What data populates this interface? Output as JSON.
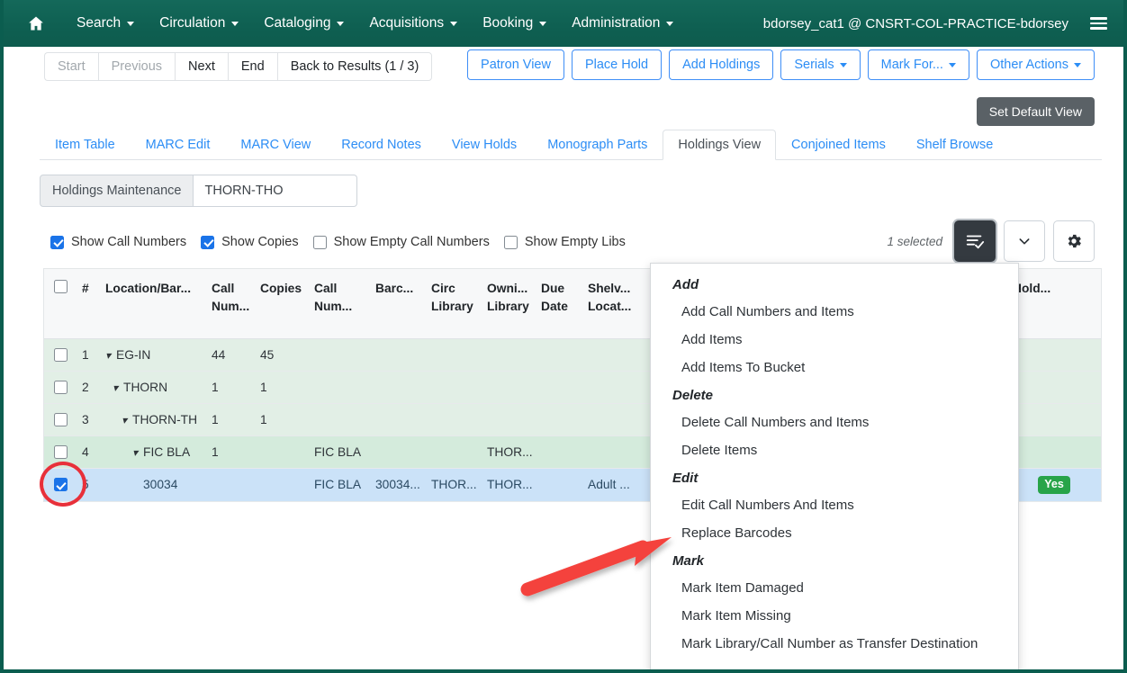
{
  "navbar": {
    "home_icon": "home-icon",
    "items": [
      {
        "label": "Search",
        "caret": true
      },
      {
        "label": "Circulation",
        "caret": true
      },
      {
        "label": "Cataloging",
        "caret": true
      },
      {
        "label": "Acquisitions",
        "caret": true
      },
      {
        "label": "Booking",
        "caret": true
      },
      {
        "label": "Administration",
        "caret": true
      }
    ],
    "user": "bdorsey_cat1 @ CNSRT-COL-PRACTICE-bdorsey",
    "menu_icon": "hamburger-menu-icon",
    "background_color": "#0f6052"
  },
  "toolbar": {
    "nav_buttons": [
      {
        "label": "Start",
        "disabled": true
      },
      {
        "label": "Previous",
        "disabled": true
      },
      {
        "label": "Next",
        "disabled": false
      },
      {
        "label": "End",
        "disabled": false
      },
      {
        "label": "Back to Results (1 / 3)",
        "disabled": false
      }
    ],
    "action_buttons": [
      {
        "label": "Patron View",
        "caret": false
      },
      {
        "label": "Place Hold",
        "caret": false
      },
      {
        "label": "Add Holdings",
        "caret": false
      },
      {
        "label": "Serials",
        "caret": true
      },
      {
        "label": "Mark For...",
        "caret": true
      },
      {
        "label": "Other Actions",
        "caret": true
      }
    ],
    "accent_color": "#2c8df5"
  },
  "tabs": {
    "items": [
      {
        "label": "Item Table",
        "active": false
      },
      {
        "label": "MARC Edit",
        "active": false
      },
      {
        "label": "MARC View",
        "active": false
      },
      {
        "label": "Record Notes",
        "active": false
      },
      {
        "label": "View Holds",
        "active": false
      },
      {
        "label": "Monograph Parts",
        "active": false
      },
      {
        "label": "Holdings View",
        "active": true
      },
      {
        "label": "Conjoined Items",
        "active": false
      },
      {
        "label": "Shelf Browse",
        "active": false
      }
    ],
    "set_default_view": "Set Default View"
  },
  "holdings_maintenance": {
    "label": "Holdings Maintenance",
    "value": "THORN-THO",
    "placeholder": ""
  },
  "display_options": [
    {
      "label": "Show Call Numbers",
      "checked": true
    },
    {
      "label": "Show Copies",
      "checked": true
    },
    {
      "label": "Show Empty Call Numbers",
      "checked": false
    },
    {
      "label": "Show Empty Libs",
      "checked": false
    }
  ],
  "grid_controls": {
    "selected_text": "1 selected",
    "actions_icon": "list-check-icon",
    "chevron_icon": "chevron-down-icon",
    "settings_icon": "gear-icon"
  },
  "table": {
    "headers": [
      "#",
      "Location/Bar...",
      "Call Num...",
      "Copies",
      "Call Num...",
      "Barc...",
      "Circ Library",
      "Owni... Library",
      "Due Date",
      "Shelv... Locat...",
      "Hold..."
    ],
    "rows": [
      {
        "num": "1",
        "checked": false,
        "level": 1,
        "twisty": true,
        "location": "EG-IN",
        "call_num_1": "44",
        "copies": "45",
        "call_num_2": "",
        "barcode": "",
        "circ_library": "",
        "owning_library": "",
        "due_date": "",
        "shelving_location": "",
        "holdable": ""
      },
      {
        "num": "2",
        "checked": false,
        "level": 1,
        "twisty": true,
        "location": "THORN",
        "call_num_1": "1",
        "copies": "1",
        "call_num_2": "",
        "barcode": "",
        "circ_library": "",
        "owning_library": "",
        "due_date": "",
        "shelving_location": "",
        "holdable": ""
      },
      {
        "num": "3",
        "checked": false,
        "level": 1,
        "twisty": true,
        "location": "THORN-TH",
        "call_num_1": "1",
        "copies": "1",
        "call_num_2": "",
        "barcode": "",
        "circ_library": "",
        "owning_library": "",
        "due_date": "",
        "shelving_location": "",
        "holdable": ""
      },
      {
        "num": "4",
        "checked": false,
        "level": 2,
        "twisty": true,
        "location": "FIC BLA",
        "call_num_1": "1",
        "copies": "",
        "call_num_2": "FIC BLA",
        "barcode": "",
        "circ_library": "",
        "owning_library": "THOR...",
        "due_date": "",
        "shelving_location": "",
        "holdable": ""
      },
      {
        "num": "5",
        "checked": true,
        "level": 3,
        "twisty": false,
        "selected": true,
        "location": "30034",
        "call_num_1": "",
        "copies": "",
        "call_num_2": "FIC BLA",
        "barcode": "30034...",
        "circ_library": "THOR...",
        "owning_library": "THOR...",
        "due_date": "",
        "shelving_location": "Adult ...",
        "holdable": "Yes"
      }
    ]
  },
  "actions_menu": {
    "groups": [
      {
        "header": "Add",
        "items": [
          "Add Call Numbers and Items",
          "Add Items",
          "Add Items To Bucket"
        ]
      },
      {
        "header": "Delete",
        "items": [
          "Delete Call Numbers and Items",
          "Delete Items"
        ]
      },
      {
        "header": "Edit",
        "items": [
          "Edit Call Numbers And Items",
          "Replace Barcodes"
        ]
      },
      {
        "header": "Mark",
        "items": [
          "Mark Item Damaged",
          "Mark Item Missing",
          "Mark Library/Call Number as Transfer Destination"
        ]
      }
    ]
  },
  "annotations": {
    "circle_color": "#e8303a",
    "arrow_color": "#f4433c",
    "arrow_target": "Replace Barcodes",
    "circle_target": "row-5-checkbox"
  }
}
